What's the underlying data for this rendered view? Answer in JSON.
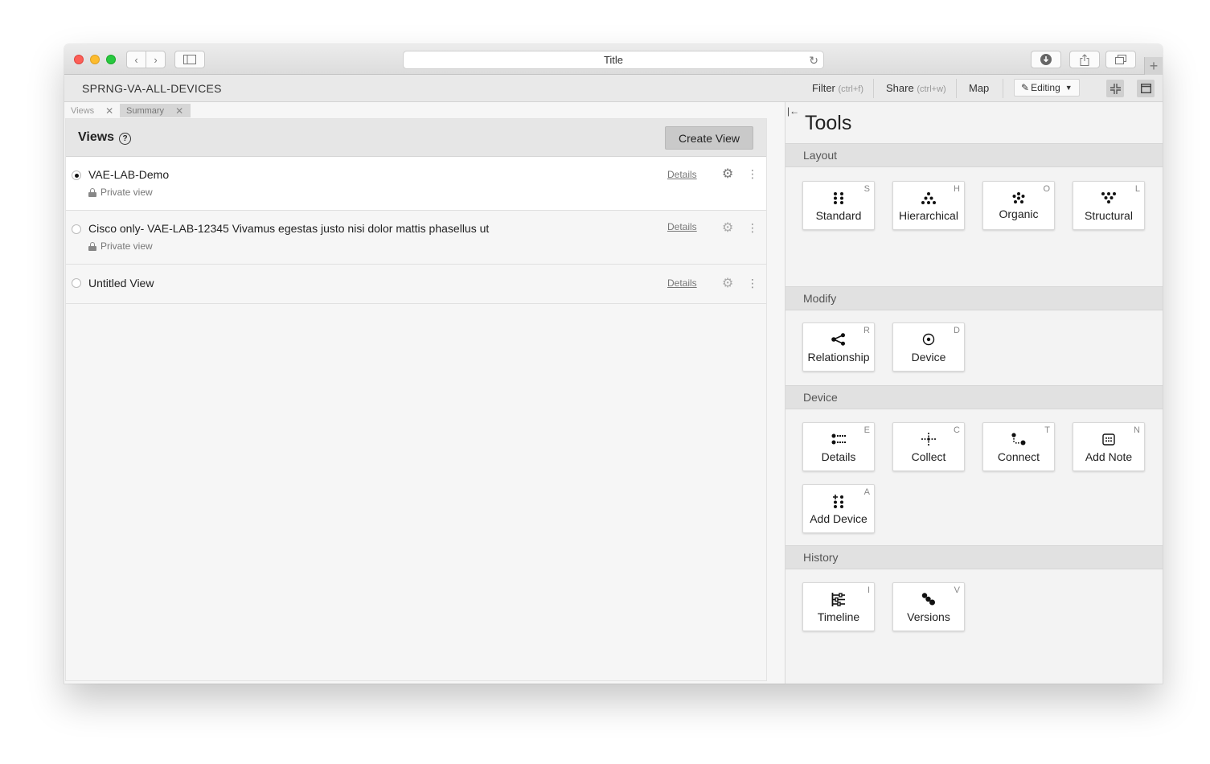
{
  "browser": {
    "address_title": "Title"
  },
  "header": {
    "app_title": "SPRNG-VA-ALL-DEVICES",
    "filter_label": "Filter",
    "filter_hint": "(ctrl+f)",
    "share_label": "Share",
    "share_hint": "(ctrl+w)",
    "map_label": "Map",
    "editing_label": "Editing"
  },
  "doc_tabs": [
    {
      "label": "Views"
    },
    {
      "label": "Summary"
    }
  ],
  "views_panel": {
    "title": "Views",
    "create_button": "Create View",
    "rows": [
      {
        "name": "VAE-LAB-Demo",
        "sub": "Private view",
        "details": "Details",
        "selected": true
      },
      {
        "name": "Cisco only- VAE-LAB-12345 Vivamus egestas justo nisi dolor mattis phasellus ut",
        "sub": "Private view",
        "details": "Details",
        "selected": false
      },
      {
        "name": "Untitled View",
        "sub": "",
        "details": "Details",
        "selected": false
      }
    ]
  },
  "tools": {
    "title": "Tools",
    "sections": [
      {
        "title": "Layout",
        "items": [
          {
            "label": "Standard",
            "key": "S",
            "icon": "standard-layout-icon"
          },
          {
            "label": "Hierarchical",
            "key": "H",
            "icon": "hierarchical-layout-icon"
          },
          {
            "label": "Organic",
            "key": "O",
            "icon": "organic-layout-icon"
          },
          {
            "label": "Structural",
            "key": "L",
            "icon": "structural-layout-icon"
          }
        ]
      },
      {
        "title": "Modify",
        "items": [
          {
            "label": "Relationship",
            "key": "R",
            "icon": "relationship-icon"
          },
          {
            "label": "Device",
            "key": "D",
            "icon": "device-target-icon"
          }
        ]
      },
      {
        "title": "Device",
        "items": [
          {
            "label": "Details",
            "key": "E",
            "icon": "details-icon"
          },
          {
            "label": "Collect",
            "key": "C",
            "icon": "collect-icon"
          },
          {
            "label": "Connect",
            "key": "T",
            "icon": "connect-icon"
          },
          {
            "label": "Add Note",
            "key": "N",
            "icon": "add-note-icon"
          },
          {
            "label": "Add Device",
            "key": "A",
            "icon": "add-device-icon"
          }
        ]
      },
      {
        "title": "History",
        "items": [
          {
            "label": "Timeline",
            "key": "I",
            "icon": "timeline-icon"
          },
          {
            "label": "Versions",
            "key": "V",
            "icon": "versions-icon"
          }
        ]
      }
    ]
  }
}
